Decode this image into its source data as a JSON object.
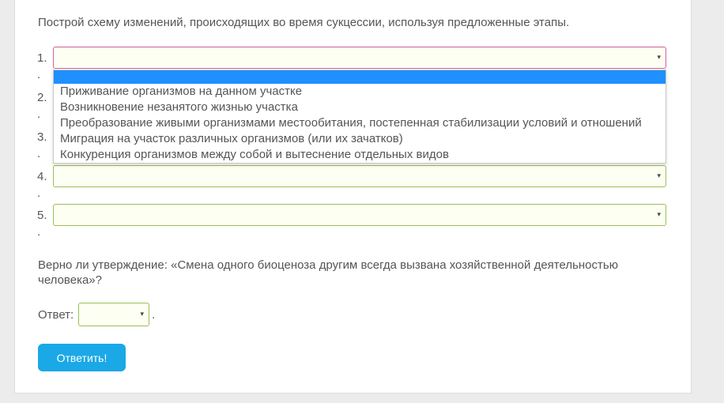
{
  "instruction": "Построй схему изменений, происходящих во время сукцессии, используя предложенные этапы.",
  "steps": [
    {
      "number": "1.",
      "dot": ".",
      "value": "",
      "active": true
    },
    {
      "number": "2.",
      "dot": ".",
      "value": ""
    },
    {
      "number": "3.",
      "dot": ".",
      "value": ""
    },
    {
      "number": "4.",
      "dot": ".",
      "value": ""
    },
    {
      "number": "5.",
      "dot": ".",
      "value": ""
    }
  ],
  "select_arrow": "▾",
  "dropdown": {
    "options": [
      "Приживание организмов на данном участке",
      "Возникновение незанятого жизнью участка",
      "Преобразование живыми организмами местообитания, постепенная стабилизации условий и отношений",
      "Миграция на участок различных организмов (или их зачатков)",
      "Конкуренция организмов между собой и вытеснение отдельных видов"
    ],
    "highlight_color": "#1e90ff"
  },
  "question": "Верно ли утверждение: «Смена одного биоценоза другим всегда вызвана хозяйственной деятельностью человека»?",
  "answer": {
    "label": "Ответ:",
    "value": "",
    "trailing": "."
  },
  "submit_label": "Ответить!",
  "colors": {
    "submit": "#1aa8e6",
    "select_border": "#9bbf55",
    "active_border": "#d0609b"
  }
}
